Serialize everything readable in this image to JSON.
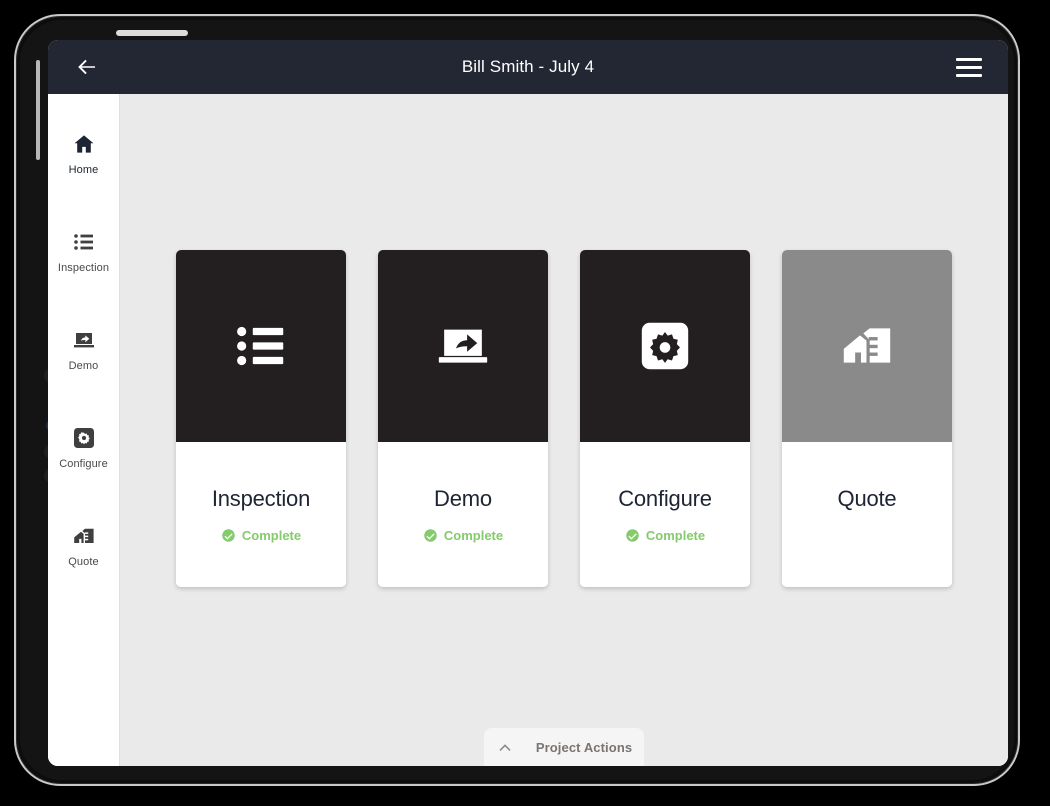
{
  "header": {
    "title": "Bill Smith - July 4",
    "back_icon": "arrow-left-icon",
    "menu_icon": "hamburger-menu-icon"
  },
  "sidebar": {
    "items": [
      {
        "label": "Home",
        "icon": "home-icon",
        "active": true
      },
      {
        "label": "Inspection",
        "icon": "list-icon",
        "active": false
      },
      {
        "label": "Demo",
        "icon": "presentation-share-icon",
        "active": false
      },
      {
        "label": "Configure",
        "icon": "gear-icon",
        "active": false
      },
      {
        "label": "Quote",
        "icon": "house-ruler-icon",
        "active": false
      }
    ]
  },
  "main": {
    "cards": [
      {
        "title": "Inspection",
        "icon": "list-icon",
        "status": "Complete",
        "status_icon": "check-circle-icon",
        "disabled": false
      },
      {
        "title": "Demo",
        "icon": "presentation-share-icon",
        "status": "Complete",
        "status_icon": "check-circle-icon",
        "disabled": false
      },
      {
        "title": "Configure",
        "icon": "gear-icon",
        "status": "Complete",
        "status_icon": "check-circle-icon",
        "disabled": false
      },
      {
        "title": "Quote",
        "icon": "house-ruler-icon",
        "status": "",
        "status_icon": "",
        "disabled": true
      }
    ]
  },
  "footer": {
    "project_actions_label": "Project Actions",
    "chevron_icon": "chevron-up-icon"
  },
  "colors": {
    "header_bg": "#222733",
    "card_dark": "#231f20",
    "card_disabled": "#8a8a8a",
    "content_bg": "#eaeaea",
    "status_green": "#84cb6b",
    "sidebar_bg": "#ffffff"
  }
}
